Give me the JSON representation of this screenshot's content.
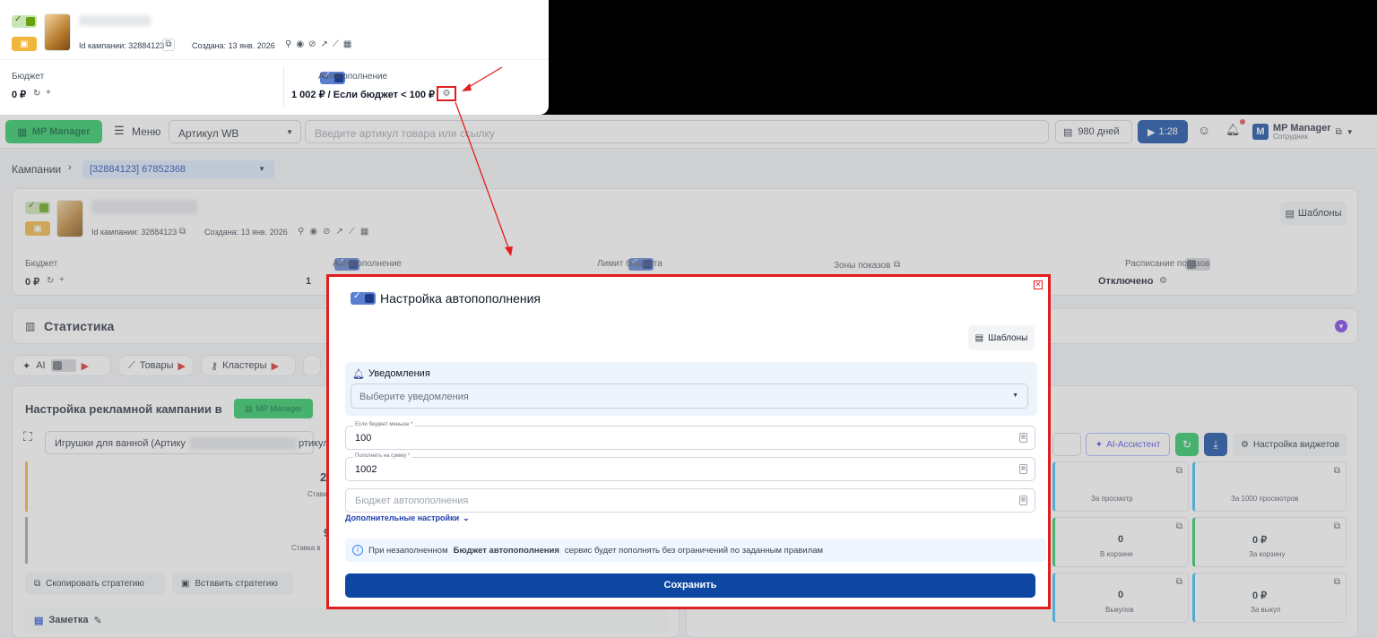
{
  "zoom_card": {
    "campaign_id": "Id кампании: 32884123",
    "created": "Создана: 13 янв. 2026",
    "budget_label": "Бюджет",
    "budget_value": "0 ₽",
    "autofill_label": "Автопополнение",
    "autofill_value": "1 002 ₽ / Если бюджет < 100 ₽"
  },
  "topbar": {
    "brand": "MP Manager",
    "menu": "Меню",
    "article_select": "Артикул WB",
    "search_placeholder": "Введите артикул товара или ссылку",
    "days": "980 дней",
    "video_time": "1:28",
    "account_name": "MP Manager",
    "account_role": "Сотрудник"
  },
  "breadcrumb": {
    "root": "Кампании",
    "current": "[32884123] 67852368"
  },
  "campaign": {
    "campaign_id": "Id кампании: 32884123",
    "created": "Создана: 13 янв. 2026",
    "templates_button": "Шаблоны",
    "budget_label": "Бюджет",
    "budget_value": "0 ₽",
    "autofill_label": "Автопополнение",
    "autofill_value_partial": "1",
    "budget_limit_label": "Лимит бюджета",
    "zones_label": "Зоны показов",
    "schedule_label": "Расписание показов",
    "schedule_value": "Отключено"
  },
  "statistics": {
    "title": "Статистика"
  },
  "tabs": [
    {
      "label": "AI"
    },
    {
      "label": "Товары"
    },
    {
      "label": "Кластеры"
    }
  ],
  "settings_panel": {
    "title": "Настройка рекламной кампании в",
    "badge": "MP Manager",
    "product": "Игрушки для ванной (Артику",
    "product_tail": "ртикул",
    "metric1_value": "2",
    "metric1_label": "Ставк",
    "metric2_value": "9",
    "metric2_label": "Ставка в",
    "copy_strategy": "Скопировать стратегию",
    "paste_strategy": "Вставить стратегию",
    "note": "Заметка"
  },
  "right_panel": {
    "ai_assistant": "AI-Ассистент",
    "widget_settings": "Настройка виджетов",
    "tiles": [
      {
        "value": "",
        "label": "За просмотр"
      },
      {
        "value": "",
        "label": "За 1000 просмотров"
      },
      {
        "value": "0",
        "label": "В корзине"
      },
      {
        "value": "0 ₽",
        "label": "За корзину"
      },
      {
        "value": "0",
        "label": "Выкупов"
      },
      {
        "value": "0 ₽",
        "label": "За выкуп"
      }
    ]
  },
  "modal": {
    "title": "Настройка автопополнения",
    "templates_button": "Шаблоны",
    "notifications_label": "Уведомления",
    "notifications_placeholder": "Выберите уведомления",
    "field_threshold_label": "Если бюджет меньше *",
    "field_threshold_value": "100",
    "field_amount_label": "Пополнить на сумму *",
    "field_amount_value": "1002",
    "field_budget_placeholder": "Бюджет автопополнения",
    "advanced_link": "Дополнительные настройки",
    "info_prefix": "При незаполненном",
    "info_bold": "Бюджет автопополнения",
    "info_suffix": "сервис будет пополнять без ограничений по заданным правилам",
    "save_button": "Сохранить"
  },
  "colors": {
    "annotation_red": "#e11d1d",
    "primary_blue": "#0d47a1",
    "brand_green": "#22c55e"
  }
}
